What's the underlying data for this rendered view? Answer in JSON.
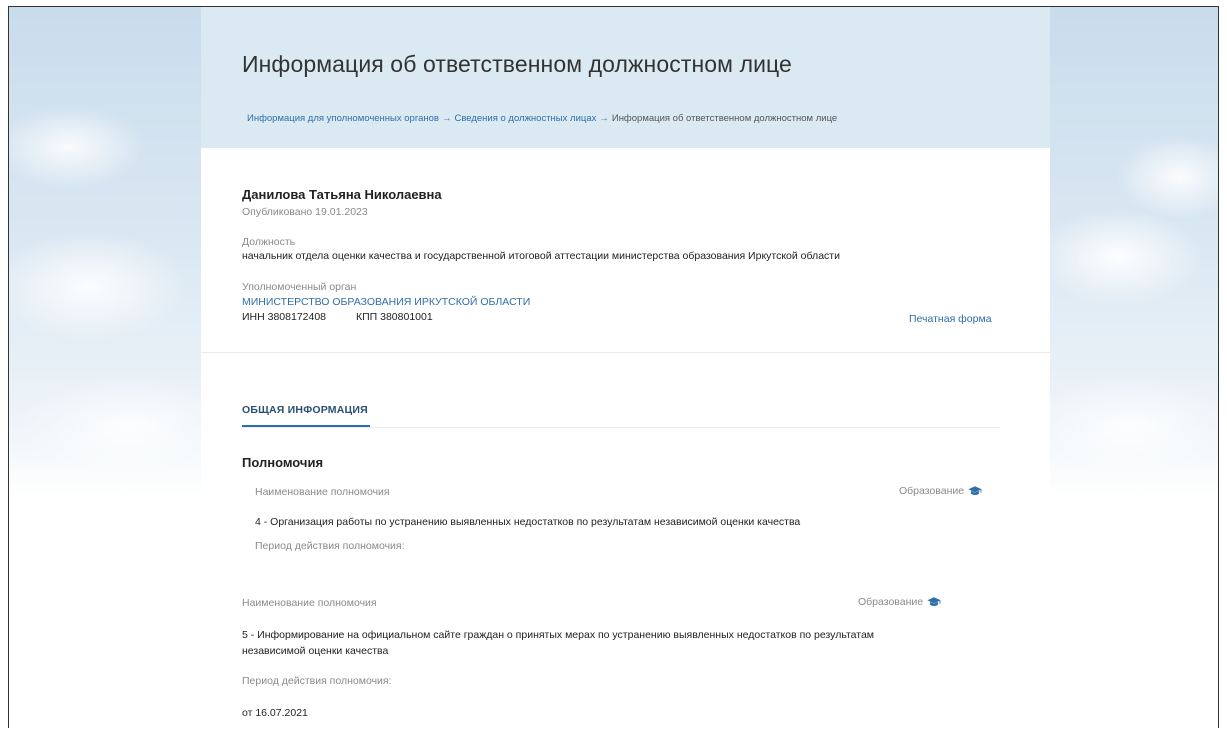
{
  "header": {
    "title": "Информация об ответственном должностном лице",
    "breadcrumbs": [
      "Информация для уполномоченных органов",
      "Сведения о должностных лицах",
      "Информация об ответственном должностном лице"
    ],
    "separator": "→"
  },
  "person": {
    "name": "Данилова Татьяна Николаевна",
    "published": "Опубликовано 19.01.2023",
    "position_label": "Должность",
    "position_value": "начальник отдела оценки качества и государственной итоговой аттестации министерства образования Иркутской области",
    "authority_label": "Уполномоченный орган",
    "authority_value": "МИНИСТЕРСТВО ОБРАЗОВАНИЯ ИРКУТСКОЙ ОБЛАСТИ",
    "inn": "ИНН 3808172408",
    "kpp": "КПП 380801001",
    "print_link": "Печатная форма"
  },
  "tabs": [
    {
      "label": "ОБЩАЯ ИНФОРМАЦИЯ",
      "active": true
    }
  ],
  "powers": {
    "title": "Полномочия",
    "items": [
      {
        "name_label": "Наименование полномочия",
        "category": "Образование",
        "value": "4 - Организация работы по устранению выявленных недостатков по результатам независимой оценки качества",
        "period_label": "Период действия полномочия:",
        "period_value": ""
      },
      {
        "name_label": "Наименование полномочия",
        "category": "Образование",
        "value_line1": "5 - Информирование на официальном сайте граждан о принятых мерах по устранению выявленных недостатков по результатам",
        "value_line2": "независимой оценки качества",
        "period_label": "Период действия полномочия:",
        "period_value": "от 16.07.2021"
      }
    ]
  },
  "icons": {
    "category_icon": "graduation-cap-icon"
  },
  "colors": {
    "link": "#2f6fa8",
    "header_band": "#dbe9f3",
    "tab_active": "#2a6fb0"
  }
}
